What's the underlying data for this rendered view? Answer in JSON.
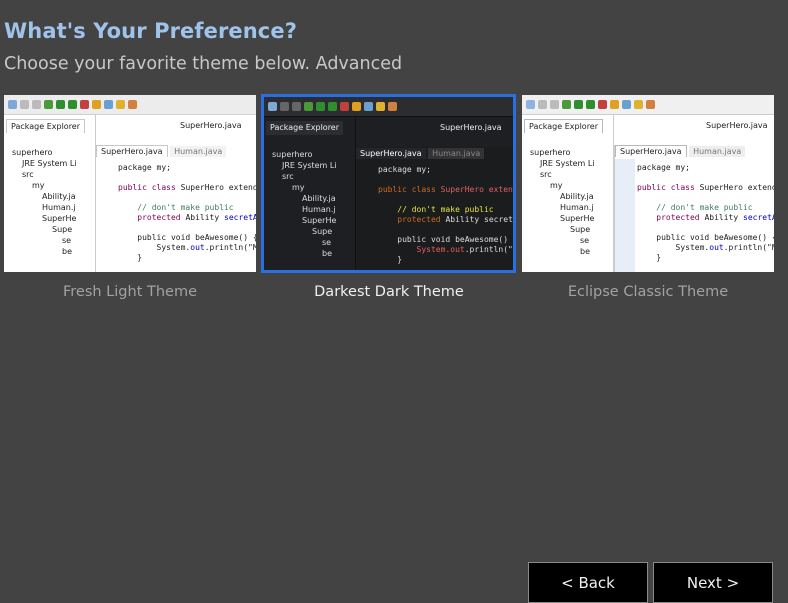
{
  "header": {
    "title": "What's Your Preference?",
    "subtitle": "Choose your favorite theme below. Advanced"
  },
  "themes": [
    {
      "label": "Fresh Light Theme",
      "selected": false
    },
    {
      "label": "Darkest Dark Theme",
      "selected": true
    },
    {
      "label": "Eclipse Classic Theme",
      "selected": false
    }
  ],
  "preview": {
    "package_explorer": "Package Explorer",
    "top_tab": "SuperHero.java",
    "tree": [
      "superhero",
      "JRE System Li",
      "src",
      "my",
      "Ability.ja",
      "Human.j",
      "SuperHe",
      "Supe",
      "se",
      "be"
    ],
    "editor_tab_active": "SuperHero.java",
    "editor_tab_inactive": "Human.java",
    "code": {
      "line1": "package my;",
      "line2_kw": "public class",
      "line2_name": "SuperHero extends",
      "line3": "// don't make public",
      "line4_kw": "protected",
      "line4_type": "Ability",
      "line4_field": "secretAbi",
      "line5": "public void beAwesome() {",
      "line6_a": "System.",
      "line6_b": "out",
      "line6_c": ".println(\"My",
      "line7": "}"
    }
  },
  "buttons": {
    "back": "< Back",
    "next": "Next >"
  },
  "colors": {
    "background": "#434343",
    "title": "#9fc3ea",
    "selection": "#2a6fe0"
  }
}
